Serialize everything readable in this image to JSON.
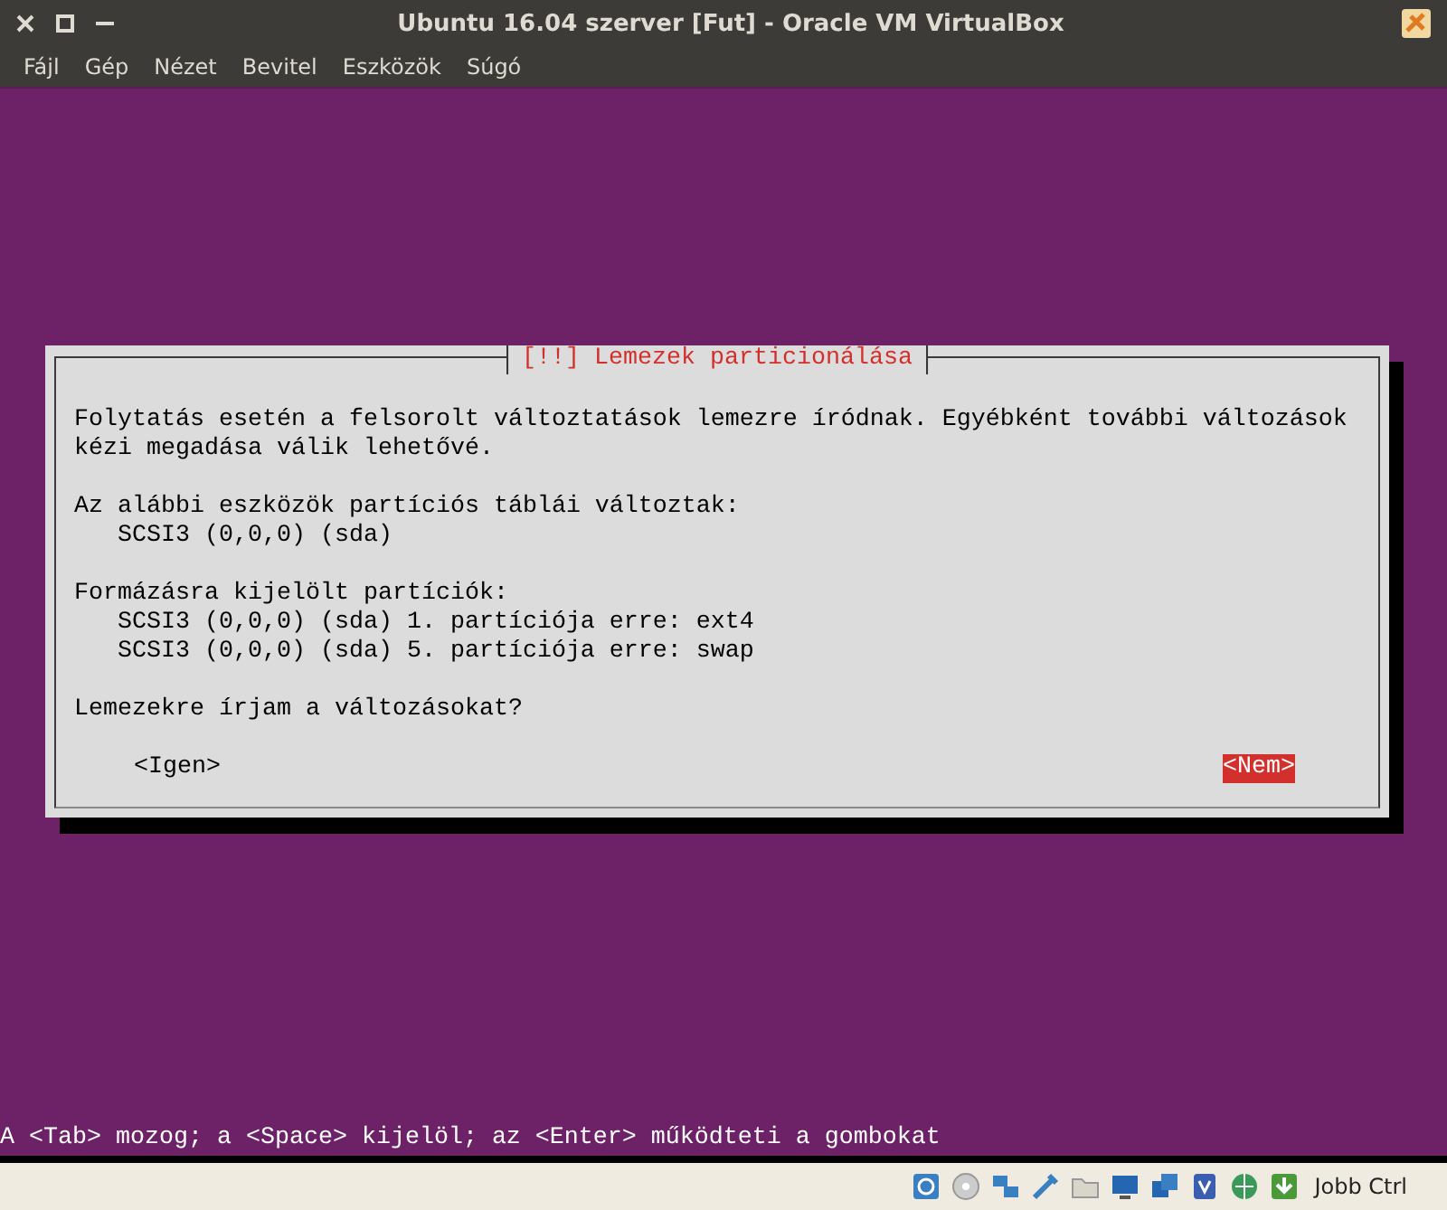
{
  "window": {
    "title": "Ubuntu 16.04 szerver [Fut] - Oracle VM VirtualBox"
  },
  "menu": [
    "Fájl",
    "Gép",
    "Nézet",
    "Bevitel",
    "Eszközök",
    "Súgó"
  ],
  "dialog": {
    "title": "[!!] Lemezek particionálása",
    "paragraphs": [
      {
        "lines": [
          "Folytatás esetén a felsorolt változtatások lemezre íródnak. Egyébként további változások",
          "kézi megadása válik lehetővé."
        ]
      },
      {
        "lines": [
          "Az alábbi eszközök partíciós táblái változtak:",
          "   SCSI3 (0,0,0) (sda)"
        ]
      },
      {
        "lines": [
          "Formázásra kijelölt partíciók:",
          "   SCSI3 (0,0,0) (sda) 1. partíciója erre: ext4",
          "   SCSI3 (0,0,0) (sda) 5. partíciója erre: swap"
        ]
      },
      {
        "lines": [
          "Lemezekre írjam a változásokat?"
        ]
      }
    ],
    "buttons": [
      {
        "label": "<Igen>",
        "selected": false
      },
      {
        "label": "<Nem>",
        "selected": true
      }
    ]
  },
  "hint": "A <Tab> mozog; a <Space> kijelöl; az <Enter> működteti a gombokat",
  "status_bar": {
    "host_key": "Jobb Ctrl"
  }
}
